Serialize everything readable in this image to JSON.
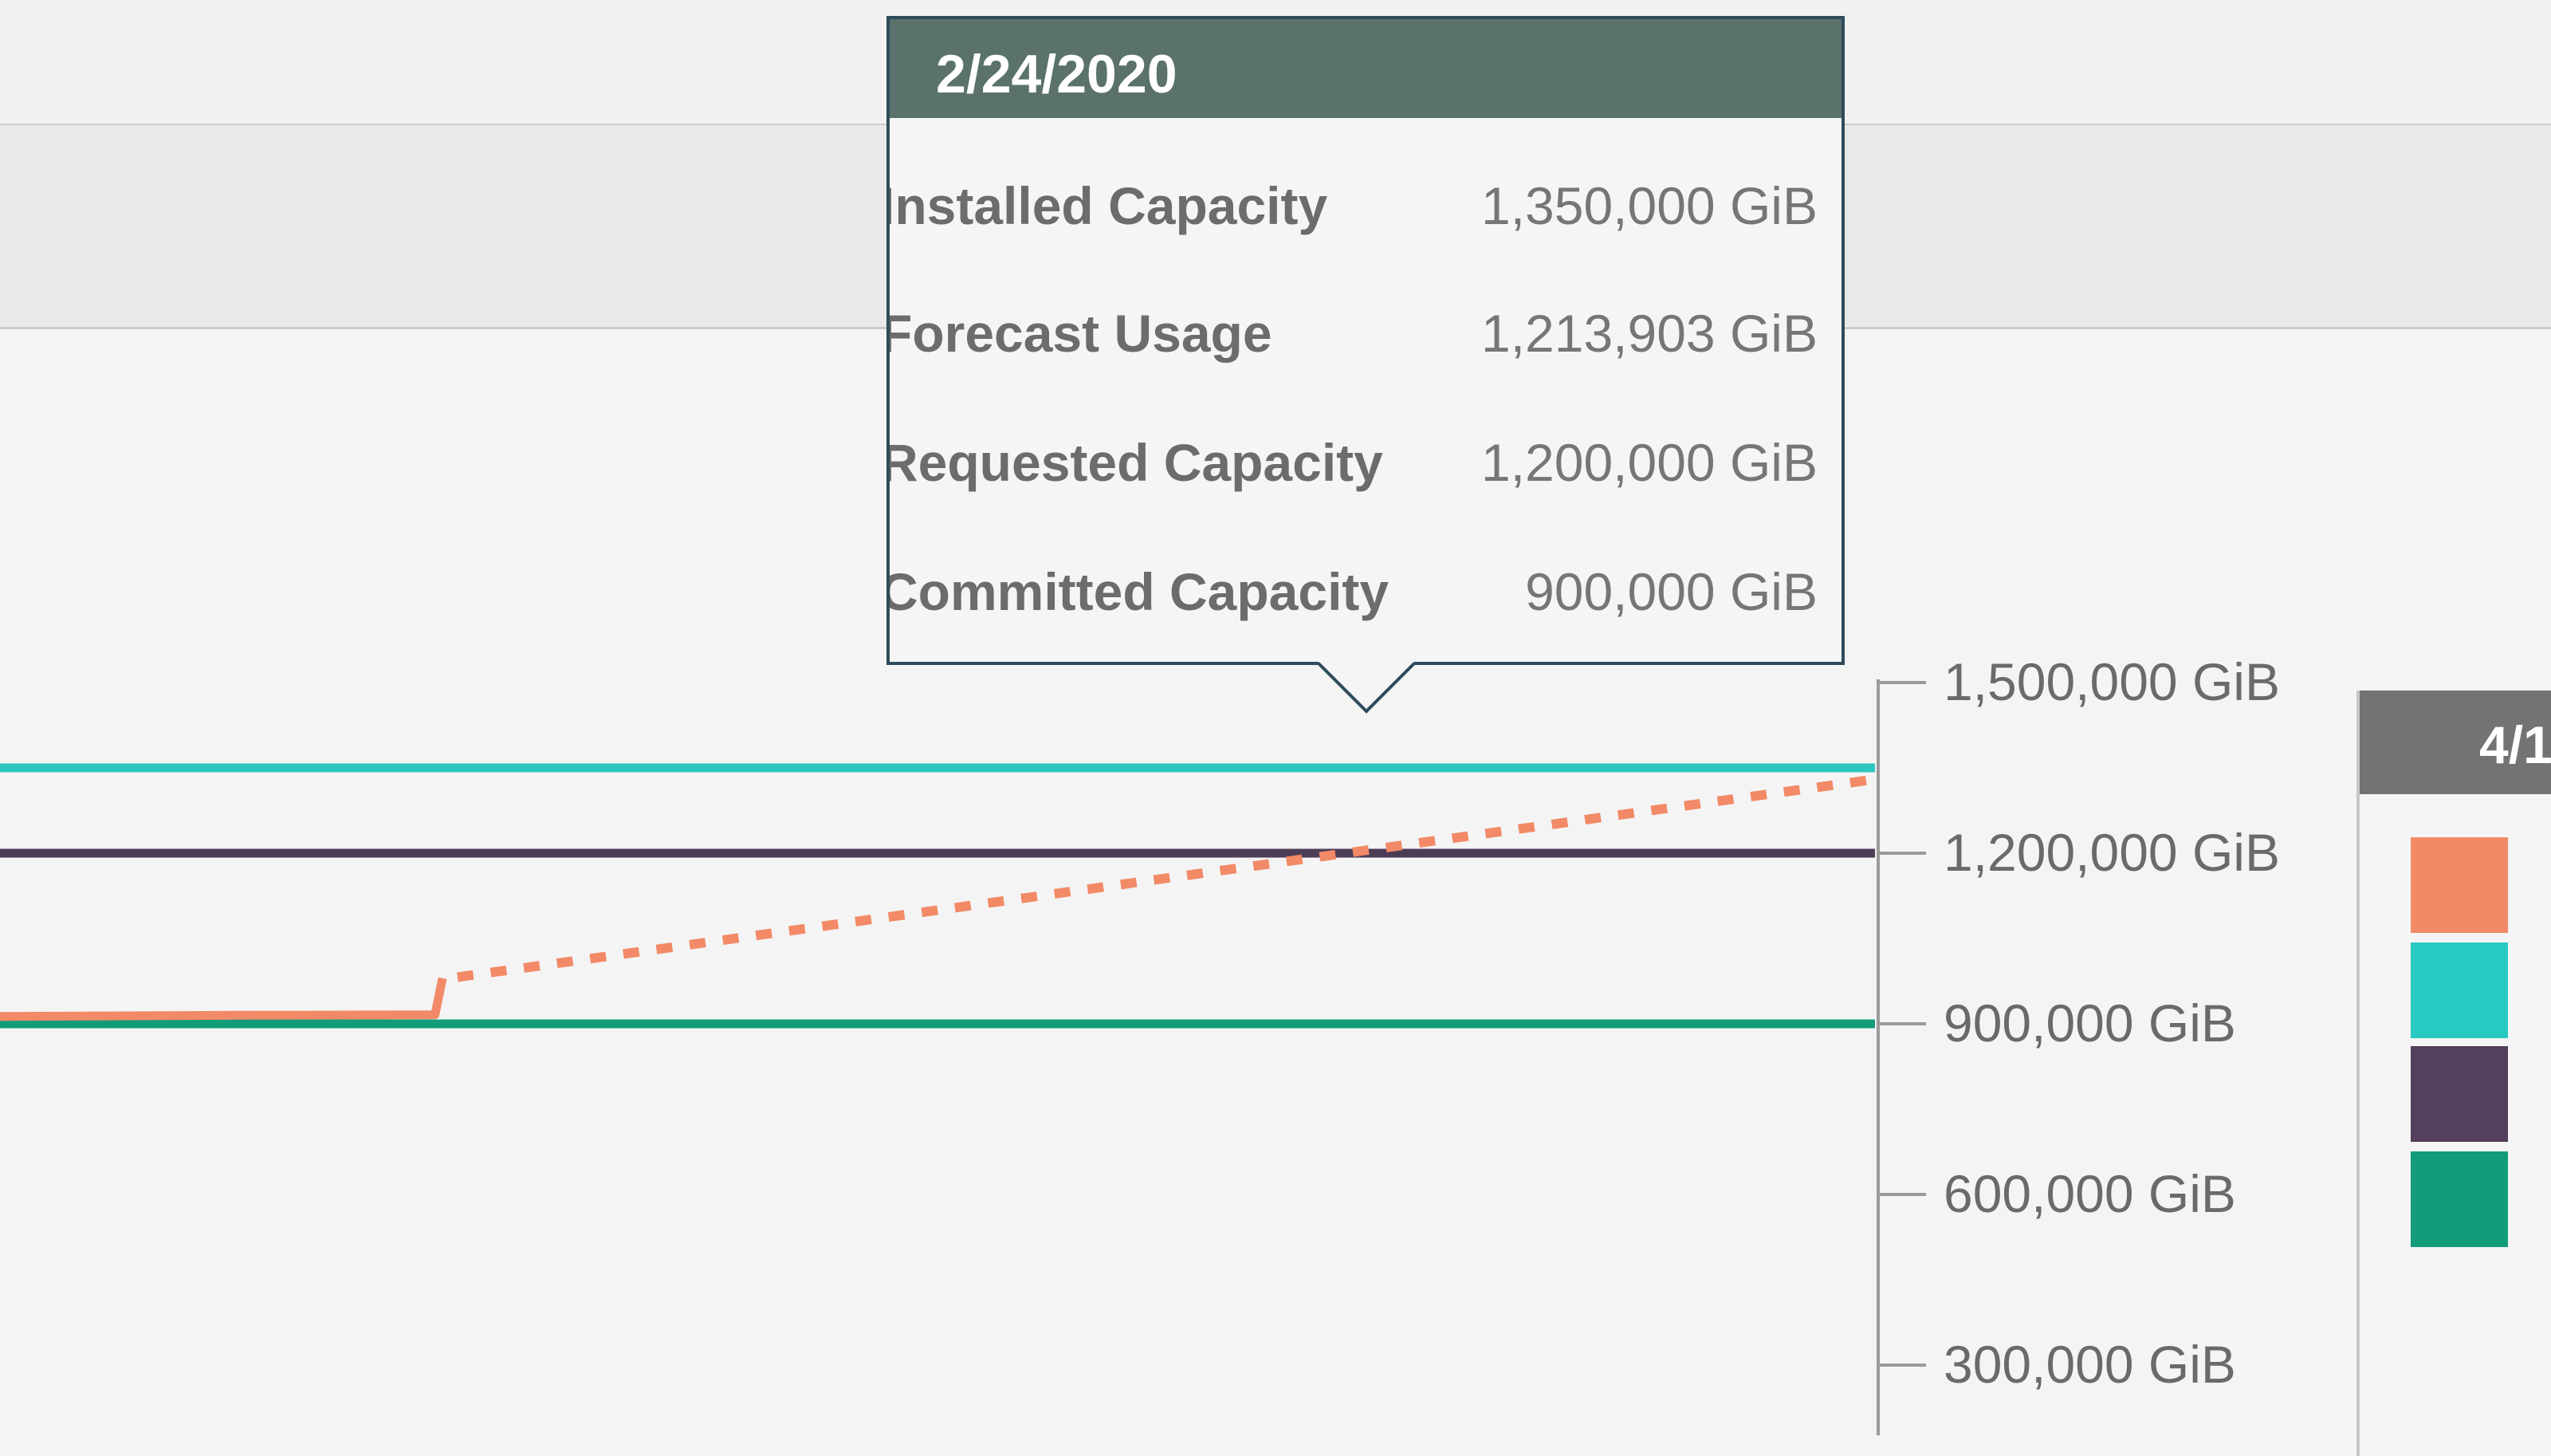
{
  "tooltip": {
    "date": "2/24/2020",
    "rows": [
      {
        "label": "Installed Capacity",
        "value": "1,350,000 GiB"
      },
      {
        "label": "Forecast Usage",
        "value": "1,213,903 GiB"
      },
      {
        "label": "Requested Capacity",
        "value": "1,200,000 GiB"
      },
      {
        "label": "Committed Capacity",
        "value": "900,000 GiB"
      }
    ]
  },
  "tooltip2": {
    "date_partial": "4/1",
    "swatch_colors": [
      "#f28a67",
      "#28c9c0",
      "#543f5c",
      "#139c7a"
    ]
  },
  "chart_data": {
    "type": "line",
    "ylim": [
      0,
      1500000
    ],
    "y_ticks": [
      300000,
      600000,
      900000,
      1200000,
      1500000
    ],
    "y_tick_labels": [
      "300,000 GiB",
      "600,000 GiB",
      "900,000 GiB",
      "1,200,000 GiB",
      "1,500,000 GiB"
    ],
    "series": [
      {
        "color": "#2cc6c0",
        "style": "solid",
        "points": [
          [
            0,
            1350000
          ],
          [
            1,
            1350000
          ]
        ]
      },
      {
        "color": "#4d3c56",
        "style": "solid",
        "points": [
          [
            0,
            1200000
          ],
          [
            1,
            1200000
          ]
        ]
      },
      {
        "color": "#139c7a",
        "style": "solid",
        "points": [
          [
            0,
            900000
          ],
          [
            1,
            900000
          ]
        ]
      },
      {
        "color": "#f28a67",
        "style": "solid",
        "points": [
          [
            0,
            913000
          ],
          [
            0.127,
            915000
          ],
          [
            0.232,
            916000
          ],
          [
            0.236,
            980000
          ]
        ]
      },
      {
        "color": "#f28a67",
        "style": "dotted",
        "points": [
          [
            0.244,
            982000
          ],
          [
            1,
            1330000
          ]
        ]
      }
    ],
    "grid": false
  }
}
